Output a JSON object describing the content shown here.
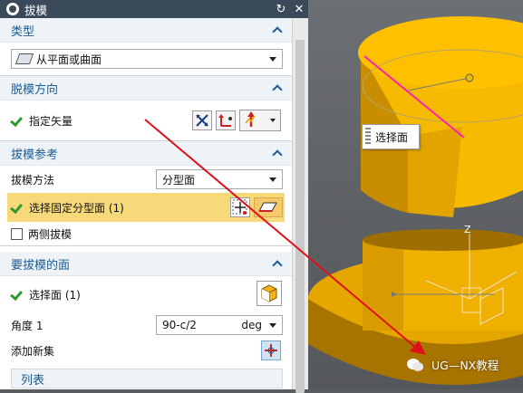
{
  "dialog": {
    "title": "拔模",
    "sections": {
      "type": {
        "header": "类型",
        "dropdown_value": "从平面或曲面"
      },
      "direction": {
        "header": "脱模方向",
        "specify_vector_label": "指定矢量"
      },
      "reference": {
        "header": "拔模参考",
        "method_label": "拔模方法",
        "method_value": "分型面",
        "select_parting_label": "选择固定分型面 (1)",
        "both_sides_label": "两侧拔模"
      },
      "faces": {
        "header": "要拔模的面",
        "select_face_label": "选择面 (1)",
        "angle_label": "角度 1",
        "angle_value": "90-c/2",
        "angle_unit": "deg",
        "add_new_set_label": "添加新集",
        "list_header": "列表"
      }
    }
  },
  "viewport": {
    "tooltip": "选择面",
    "axis_z": "Z",
    "watermark": "UG—NX教程"
  },
  "colors": {
    "accent": "#1b5b93",
    "highlight_row": "#f8d97a",
    "part_yellow": "#f5b800",
    "selected_edge": "#ff22aa",
    "arrow_red": "#e0101a"
  }
}
